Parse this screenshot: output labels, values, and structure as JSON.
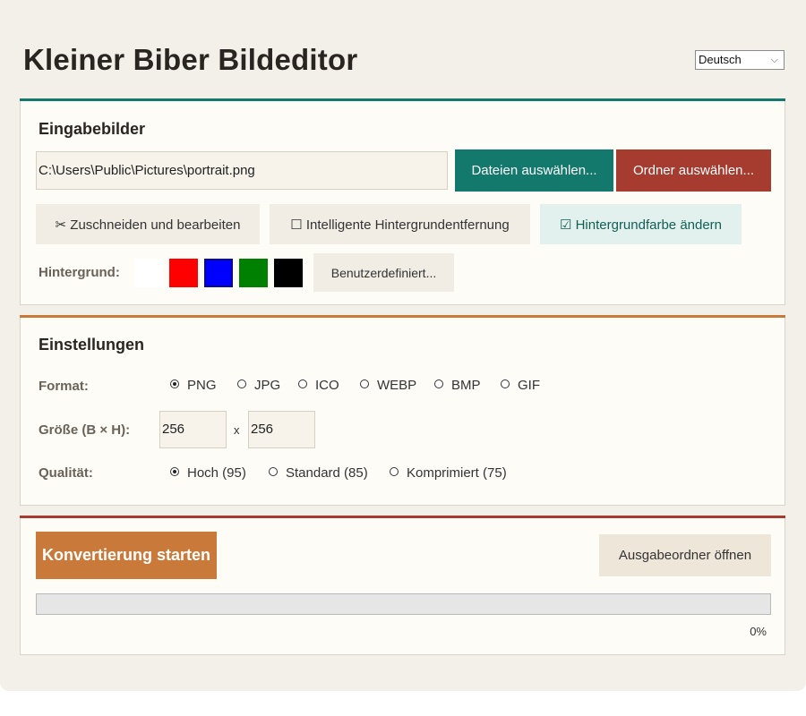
{
  "app": {
    "title": "Kleiner Biber Bildeditor",
    "language": "Deutsch"
  },
  "input_panel": {
    "title": "Eingabebilder",
    "path_value": "C:\\Users\\Public\\Pictures\\portrait.png",
    "select_files_label": "Dateien auswählen...",
    "select_folder_label": "Ordner auswählen...",
    "crop_label": "✂ Zuschneiden und bearbeiten",
    "smart_bg_label": "☐ Intelligente Hintergrundentfernung",
    "change_bg_label": "☑ Hintergrundfarbe ändern",
    "bg_label": "Hintergrund:",
    "bg_swatches": [
      {
        "color": "#ffffff",
        "selected": false
      },
      {
        "color": "#ff0000",
        "selected": false
      },
      {
        "color": "#0000ff",
        "selected": true
      },
      {
        "color": "#008000",
        "selected": false
      },
      {
        "color": "#000000",
        "selected": false
      }
    ],
    "custom_label": "Benutzerdefiniert..."
  },
  "settings_panel": {
    "title": "Einstellungen",
    "format_label": "Format:",
    "formats": [
      {
        "label": "PNG",
        "selected": true
      },
      {
        "label": "JPG",
        "selected": false
      },
      {
        "label": "ICO",
        "selected": false
      },
      {
        "label": "WEBP",
        "selected": false
      },
      {
        "label": "BMP",
        "selected": false
      },
      {
        "label": "GIF",
        "selected": false
      }
    ],
    "size_label": "Größe (B × H):",
    "width_value": "256",
    "size_sep": "x",
    "height_value": "256",
    "quality_label": "Qualität:",
    "qualities": [
      {
        "label": "Hoch (95)",
        "selected": true
      },
      {
        "label": "Standard (85)",
        "selected": false
      },
      {
        "label": "Komprimiert (75)",
        "selected": false
      }
    ]
  },
  "run_panel": {
    "start_label": "Konvertierung starten",
    "open_output_label": "Ausgabeordner öffnen",
    "progress": 0,
    "progress_text": "0%"
  },
  "colors": {
    "teal": "#12796c",
    "orange": "#c97a3a",
    "red": "#a63b2f"
  }
}
